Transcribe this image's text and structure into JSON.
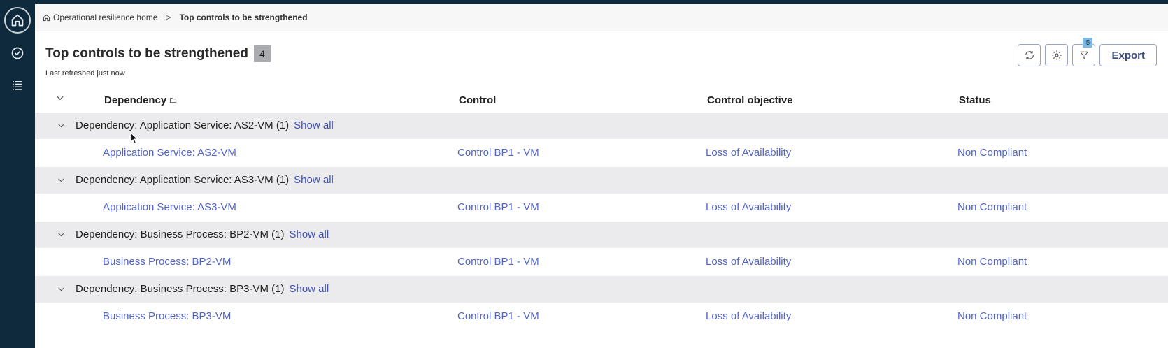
{
  "colors": {
    "sidebar": "#0f2a3d",
    "link": "#5264c8",
    "accent": "#3f51b5",
    "group_row": "#ebebed"
  },
  "nav": {
    "items": [
      {
        "icon": "home-icon"
      },
      {
        "icon": "check-circle-icon"
      },
      {
        "icon": "list-icon"
      }
    ]
  },
  "breadcrumb": {
    "home": "Operational resilience home",
    "current": "Top controls to be strengthened"
  },
  "header": {
    "title": "Top controls to be strengthened",
    "count": "4",
    "refreshed": "Last refreshed just now",
    "filter_count": "5",
    "export_label": "Export"
  },
  "table": {
    "columns": [
      "Dependency",
      "Control",
      "Control objective",
      "Status"
    ],
    "show_all_label": "Show all",
    "groups": [
      {
        "label": "Dependency: Application Service: AS2-VM (1)",
        "row": [
          "Application Service: AS2-VM",
          "Control BP1 - VM",
          "Loss of Availability",
          "Non Compliant"
        ]
      },
      {
        "label": "Dependency: Application Service: AS3-VM (1)",
        "row": [
          "Application Service: AS3-VM",
          "Control BP1 - VM",
          "Loss of Availability",
          "Non Compliant"
        ]
      },
      {
        "label": "Dependency: Business Process: BP2-VM (1)",
        "row": [
          "Business Process: BP2-VM",
          "Control BP1 - VM",
          "Loss of Availability",
          "Non Compliant"
        ]
      },
      {
        "label": "Dependency: Business Process: BP3-VM (1)",
        "row": [
          "Business Process: BP3-VM",
          "Control BP1 - VM",
          "Loss of Availability",
          "Non Compliant"
        ]
      }
    ]
  }
}
